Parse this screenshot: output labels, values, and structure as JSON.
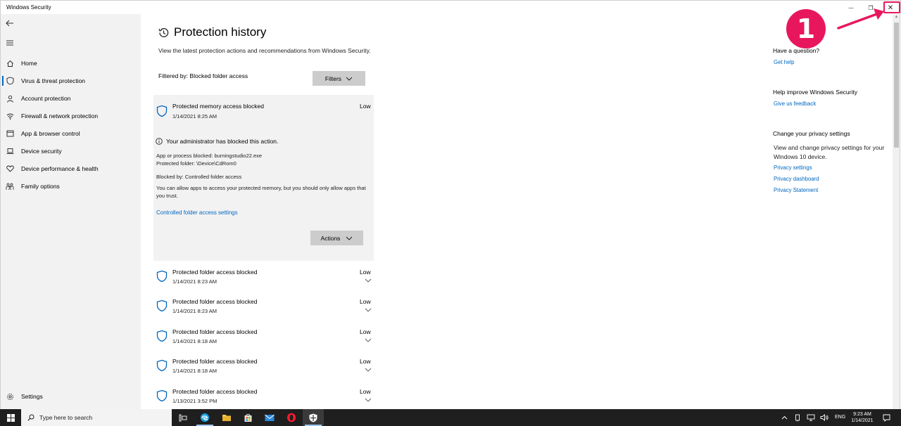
{
  "window": {
    "title": "Windows Security",
    "minimize_glyph": "—",
    "maximize_glyph": "❐",
    "close_glyph": "✕"
  },
  "sidebar": {
    "items": [
      {
        "label": "Home",
        "icon": "home-icon"
      },
      {
        "label": "Virus & threat protection",
        "icon": "shield-icon",
        "active": true
      },
      {
        "label": "Account protection",
        "icon": "person-icon"
      },
      {
        "label": "Firewall & network protection",
        "icon": "wifi-icon"
      },
      {
        "label": "App & browser control",
        "icon": "window-icon"
      },
      {
        "label": "Device security",
        "icon": "laptop-icon"
      },
      {
        "label": "Device performance & health",
        "icon": "heart-icon"
      },
      {
        "label": "Family options",
        "icon": "family-icon"
      }
    ],
    "settings_label": "Settings"
  },
  "main": {
    "title": "Protection history",
    "description": "View the latest protection actions and recommendations from Windows Security.",
    "filtered_by": "Filtered by: Blocked folder access",
    "filters_label": "Filters",
    "expanded": {
      "title": "Protected memory access blocked",
      "date": "1/14/2021 8:25 AM",
      "severity": "Low",
      "admin_message": "Your administrator has blocked this action.",
      "app_blocked": "App or process blocked: burningstudio22.exe",
      "protected_folder": "Protected folder: \\Device\\CdRom0",
      "blocked_by": "Blocked by: Controlled folder access",
      "allow_text": "You can allow apps to access your protected memory, but you should only allow apps that you trust.",
      "link": "Controlled folder access settings",
      "actions_label": "Actions"
    },
    "history": [
      {
        "title": "Protected folder access blocked",
        "date": "1/14/2021 8:23 AM",
        "severity": "Low"
      },
      {
        "title": "Protected folder access blocked",
        "date": "1/14/2021 8:23 AM",
        "severity": "Low"
      },
      {
        "title": "Protected folder access blocked",
        "date": "1/14/2021 8:18 AM",
        "severity": "Low"
      },
      {
        "title": "Protected folder access blocked",
        "date": "1/14/2021 8:18 AM",
        "severity": "Low"
      },
      {
        "title": "Protected folder access blocked",
        "date": "1/13/2021 3:52 PM",
        "severity": "Low"
      }
    ]
  },
  "right_pane": {
    "question_heading": "Have a question?",
    "get_help": "Get help",
    "improve_heading": "Help improve Windows Security",
    "feedback": "Give us feedback",
    "privacy_heading": "Change your privacy settings",
    "privacy_text": "View and change privacy settings for your Windows 10 device.",
    "privacy_settings": "Privacy settings",
    "privacy_dashboard": "Privacy dashboard",
    "privacy_statement": "Privacy Statement"
  },
  "annotation": {
    "number": "1",
    "color": "#e8175d"
  },
  "taskbar": {
    "search_placeholder": "Type here to search",
    "apps": [
      "task-view-icon",
      "edge-icon",
      "file-explorer-icon",
      "store-icon",
      "mail-icon",
      "opera-icon",
      "windows-security-icon"
    ],
    "language": "ENG",
    "time": "9:23 AM",
    "date": "1/14/2021"
  },
  "colors": {
    "accent": "#0067c0",
    "sidebar_bg": "#f2f2f2",
    "button_bg": "#cccccc",
    "taskbar_bg": "#1f1f1f"
  }
}
